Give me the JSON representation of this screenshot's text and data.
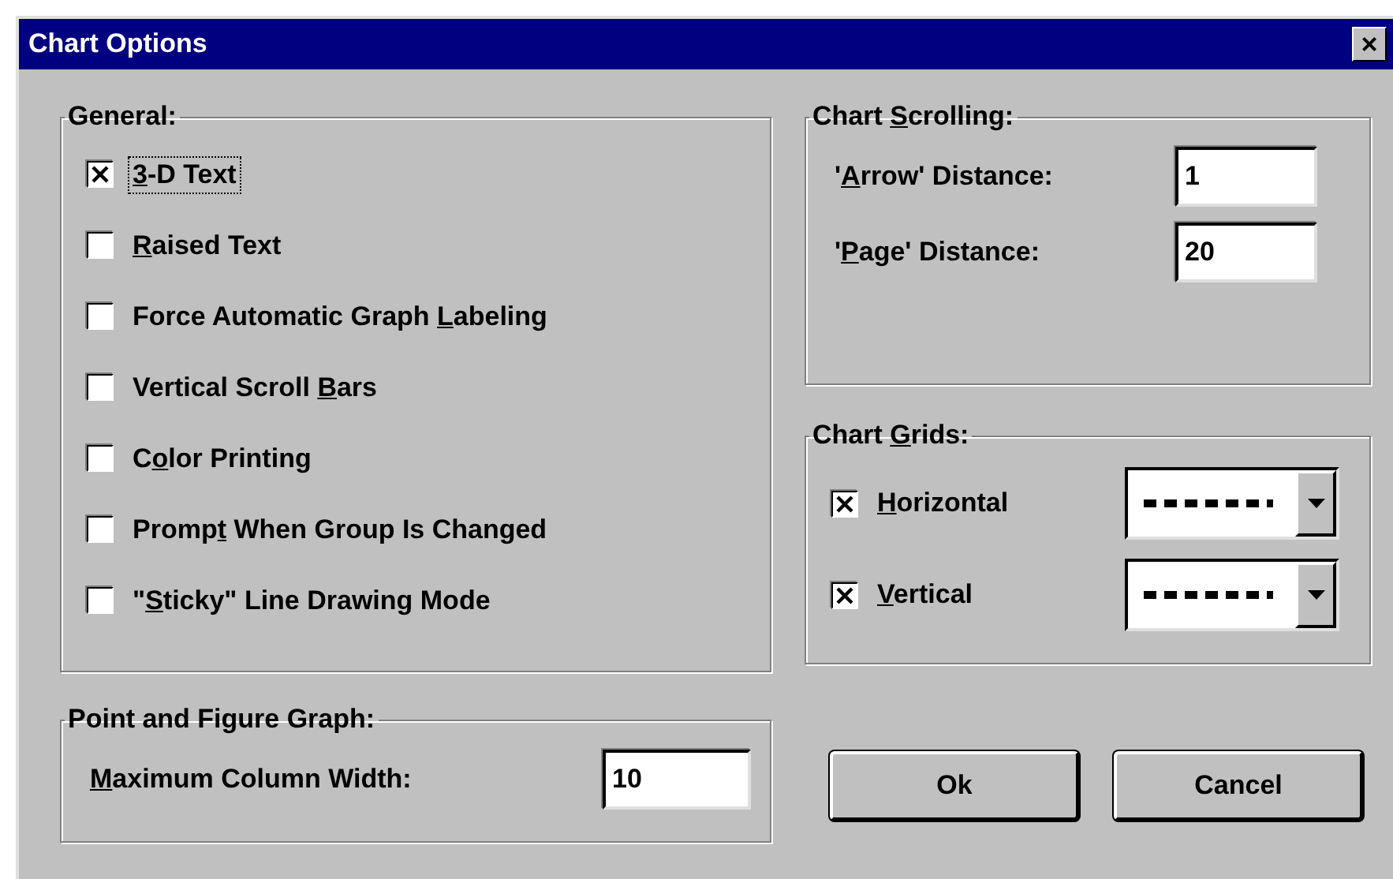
{
  "window": {
    "title": "Chart Options",
    "close": "×"
  },
  "general": {
    "title": "General:",
    "options": [
      {
        "key": "3",
        "after": "-D Text",
        "checked": true,
        "focused": true
      },
      {
        "key": "R",
        "after": "aised Text",
        "checked": false,
        "focused": false
      },
      {
        "before": "Force Automatic Graph ",
        "key": "L",
        "after": "abeling",
        "checked": false,
        "focused": false
      },
      {
        "before": "Vertical Scroll ",
        "key": "B",
        "after": "ars",
        "checked": false,
        "focused": false
      },
      {
        "before": "C",
        "key": "o",
        "after": "lor Printing",
        "checked": false,
        "focused": false
      },
      {
        "before": "Promp",
        "key": "t",
        "after": " When Group Is Changed",
        "checked": false,
        "focused": false
      },
      {
        "before": "\"",
        "key": "S",
        "after": "ticky\" Line Drawing Mode",
        "checked": false,
        "focused": false
      }
    ]
  },
  "point_and_figure": {
    "title": "Point and Figure Graph:",
    "field": {
      "key": "M",
      "after": "aximum Column Width:",
      "value": "10"
    }
  },
  "chart_scrolling": {
    "title": {
      "before": "Chart ",
      "key": "S",
      "after": "crolling:"
    },
    "fields": [
      {
        "before": "'",
        "key": "A",
        "after": "rrow' Distance:",
        "value": "1"
      },
      {
        "before": "'",
        "key": "P",
        "after": "age' Distance:",
        "value": "20"
      }
    ]
  },
  "chart_grids": {
    "title": {
      "before": "Chart ",
      "key": "G",
      "after": "rids:"
    },
    "options": [
      {
        "key": "H",
        "after": "orizontal",
        "checked": true
      },
      {
        "key": "V",
        "after": "ertical",
        "checked": true
      }
    ]
  },
  "buttons": [
    "Ok",
    "Cancel"
  ]
}
